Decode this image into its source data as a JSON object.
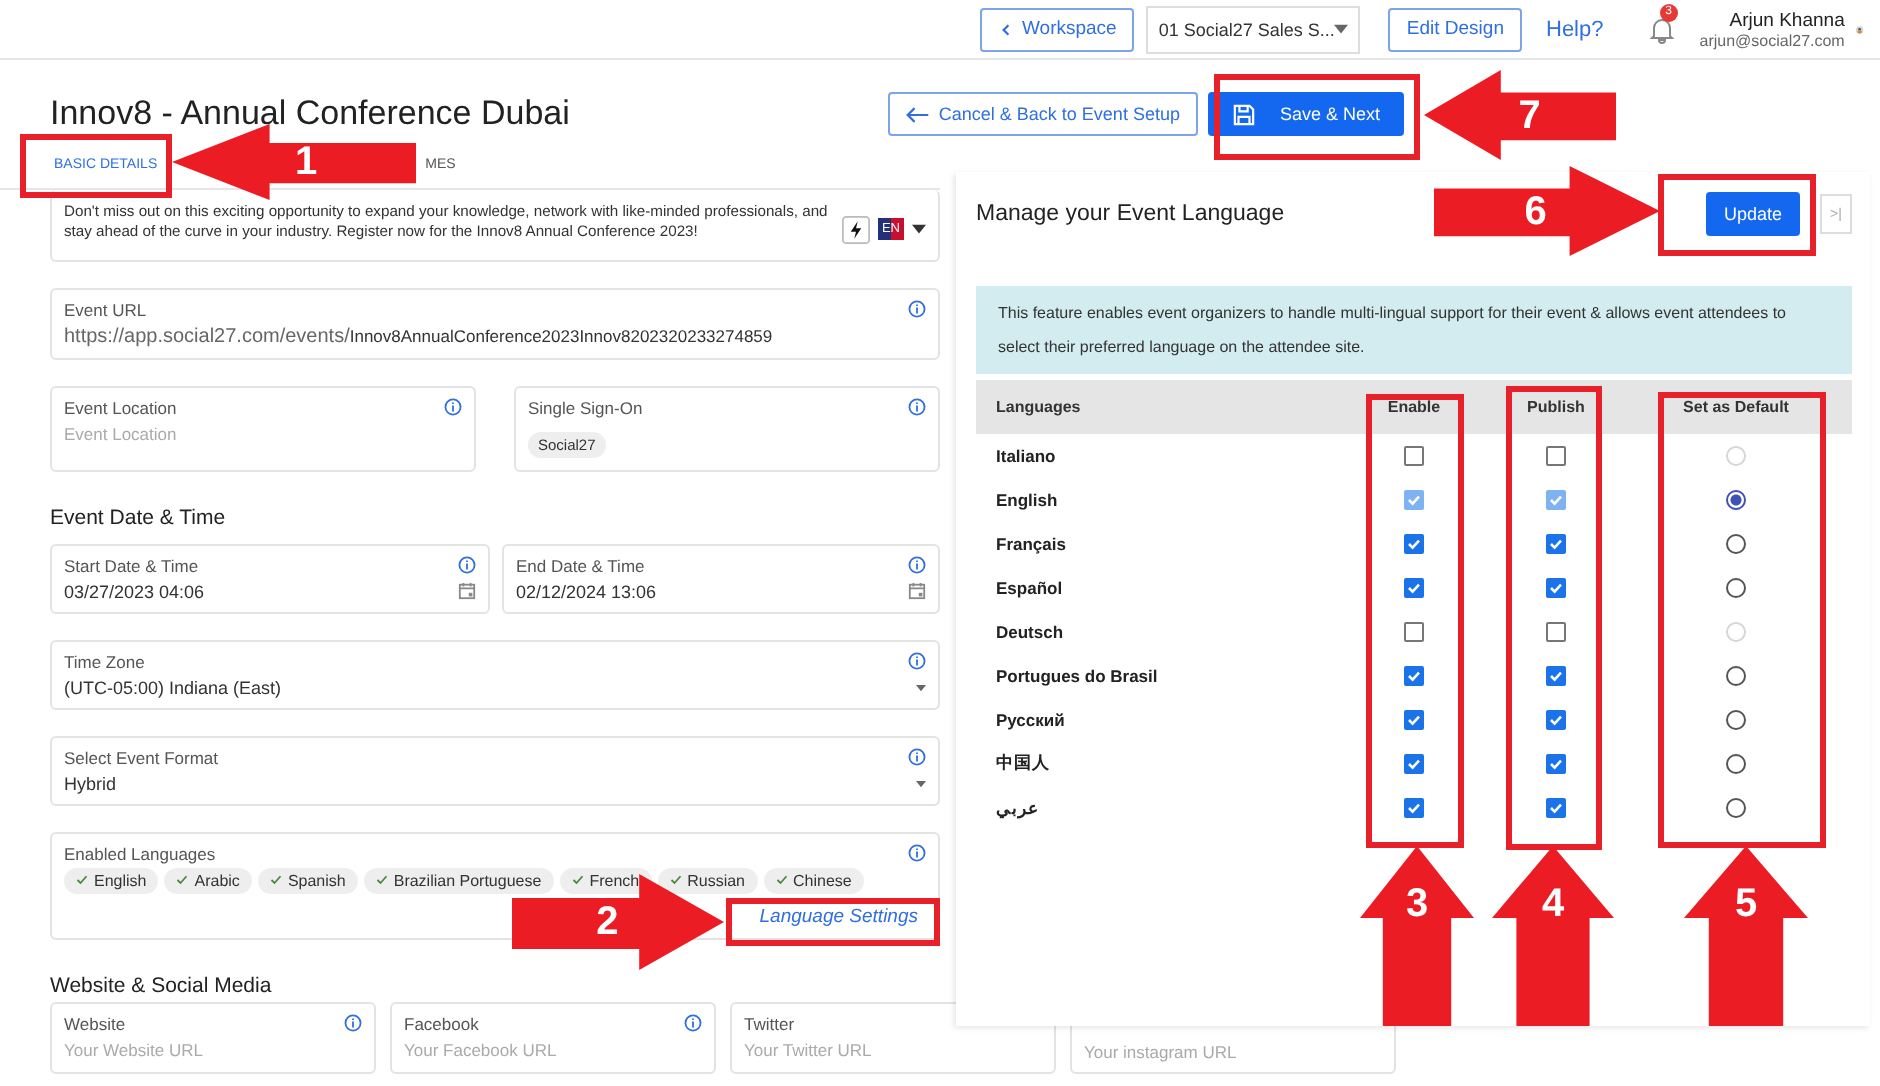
{
  "header": {
    "back_button": "Workspace",
    "event_select": "01 Social27 Sales S...",
    "edit_button": "Edit Design",
    "help_link": "Help?",
    "notification_count": "3",
    "user": {
      "name": "Arjun Khanna",
      "email": "arjun@social27.com"
    }
  },
  "page": {
    "title": "Innov8 - Annual Conference Dubai",
    "cancel_button": "Cancel & Back to Event Setup",
    "save_button": "Save & Next"
  },
  "tabs": [
    {
      "label": "BASIC DETAILS",
      "selected": true
    },
    {
      "label": "MES",
      "selected": false
    }
  ],
  "description": {
    "text": "Don't miss out on this exciting opportunity to expand your knowledge, network with like-minded professionals, and stay ahead of the curve in your industry. Register now for the Innov8 Annual Conference 2023!",
    "language_badge": "EN"
  },
  "event_url": {
    "label": "Event URL",
    "prefix": "https://app.social27.com/events/",
    "value": "Innov8AnnualConference2023Innov8202320233274859"
  },
  "location": {
    "label": "Event Location",
    "placeholder": "Event Location"
  },
  "sso": {
    "label": "Single Sign-On",
    "tags": [
      "Social27"
    ]
  },
  "date_section": "Event Date & Time",
  "start": {
    "label": "Start Date & Time",
    "value": "03/27/2023 04:06"
  },
  "end": {
    "label": "End Date & Time",
    "value": "02/12/2024 13:06"
  },
  "time_zone": {
    "label": "Time Zone",
    "value": "(UTC-05:00) Indiana (East)"
  },
  "event_format": {
    "label": "Select Event Format",
    "value": "Hybrid"
  },
  "enabled_languages": {
    "label": "Enabled Languages",
    "chips": [
      "English",
      "Arabic",
      "Spanish",
      "Brazilian Portuguese",
      "French",
      "Russian",
      "Chinese"
    ],
    "link": "Language Settings"
  },
  "social_section": "Website & Social Media",
  "social_fields": [
    {
      "label": "Website",
      "placeholder": "Your Website URL",
      "info": true
    },
    {
      "label": "Facebook",
      "placeholder": "Your Facebook URL",
      "info": true
    },
    {
      "label": "Twitter",
      "placeholder": "Your Twitter URL"
    },
    {
      "placeholder": "Your instagram URL"
    }
  ],
  "language_panel": {
    "title": "Manage your Event Language",
    "update_button": "Update",
    "collapse_button": ">|",
    "notice": "This feature enables event organizers to handle multi-lingual support for their event & allows event attendees to select their preferred language on the attendee site.",
    "columns": [
      "Languages",
      "Enable",
      "Publish",
      "Set as Default"
    ],
    "rows": [
      {
        "name": "Italiano",
        "enabled": false,
        "published": false,
        "disabled": false,
        "default": false,
        "default_disabled": true
      },
      {
        "name": "English",
        "enabled": true,
        "published": true,
        "disabled": true,
        "default": true,
        "default_disabled": false
      },
      {
        "name": "Français",
        "enabled": true,
        "published": true,
        "disabled": false,
        "default": false,
        "default_disabled": false
      },
      {
        "name": "Español",
        "enabled": true,
        "published": true,
        "disabled": false,
        "default": false,
        "default_disabled": false
      },
      {
        "name": "Deutsch",
        "enabled": false,
        "published": false,
        "disabled": false,
        "default": false,
        "default_disabled": true
      },
      {
        "name": "Portugues do Brasil",
        "enabled": true,
        "published": true,
        "disabled": false,
        "default": false,
        "default_disabled": false
      },
      {
        "name": "Русский",
        "enabled": true,
        "published": true,
        "disabled": false,
        "default": false,
        "default_disabled": false
      },
      {
        "name": "中国人",
        "enabled": true,
        "published": true,
        "disabled": false,
        "default": false,
        "default_disabled": false
      },
      {
        "name": "عربي",
        "enabled": true,
        "published": true,
        "disabled": false,
        "default": false,
        "default_disabled": false
      }
    ]
  },
  "callouts": [
    {
      "number": "7",
      "kind": "left"
    },
    {
      "number": "1",
      "kind": "left"
    },
    {
      "number": "6",
      "kind": "right"
    },
    {
      "number": "2",
      "kind": "right"
    },
    {
      "number": "3",
      "kind": "up"
    },
    {
      "number": "4",
      "kind": "up"
    },
    {
      "number": "5",
      "kind": "up"
    }
  ]
}
